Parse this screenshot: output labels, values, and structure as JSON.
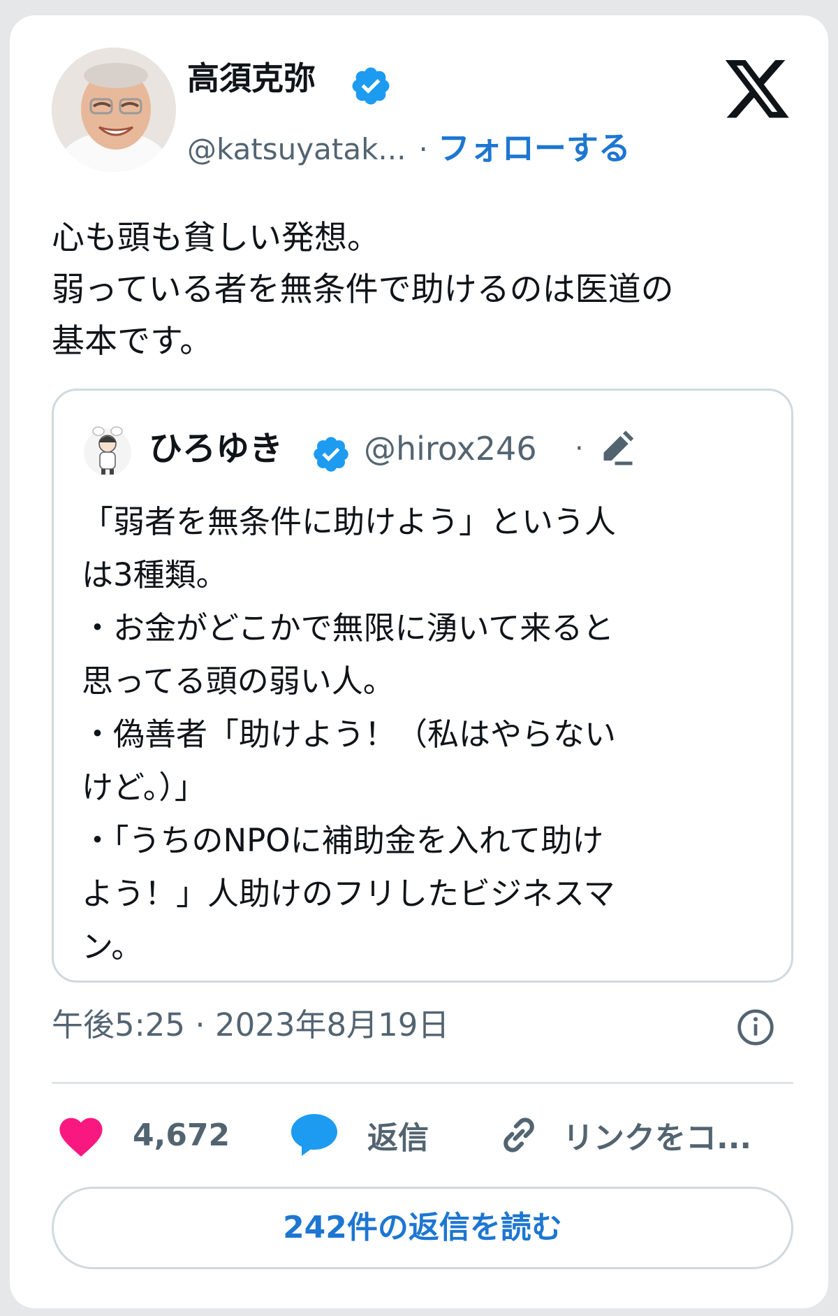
{
  "colors": {
    "accent": "#1d76d2",
    "verified": "#1d9bf0",
    "like": "#f91880",
    "muted": "#536471",
    "border": "#cfd9de"
  },
  "tweet": {
    "author_name": "高須克弥",
    "author_handle": "@katsuyatak...",
    "separator": "·",
    "follow_label": "フォローする",
    "text_lines": [
      "心も頭も貧しい発想。",
      "弱っている者を無条件で助けるのは医道の",
      "基本です。"
    ],
    "timestamp": "午後5:25 · 2023年8月19日"
  },
  "quoted": {
    "author_name": "ひろゆき",
    "author_handle": "@hirox246",
    "separator": "·",
    "text_lines": [
      "「弱者を無条件に助けよう」という人",
      "は3種類。",
      "・お金がどこかで無限に湧いて来ると",
      "思ってる頭の弱い人。",
      "・偽善者「助けよう！（私はやらない",
      "けど。）」",
      "・「うちのNPOに補助金を入れて助け",
      "よう！」人助けのフリしたビジネスマ",
      "ン。"
    ]
  },
  "actions": {
    "like_count": "4,672",
    "reply_label": "返信",
    "copy_link_label": "リンクをコ..."
  },
  "read_replies_label": "242件の返信を読む",
  "icons": {
    "platform": "x-logo-icon",
    "verified": "verified-badge-icon",
    "edit": "edited-pencil-icon",
    "info": "info-icon",
    "like": "heart-icon",
    "reply": "speech-bubble-icon",
    "link": "link-icon"
  }
}
